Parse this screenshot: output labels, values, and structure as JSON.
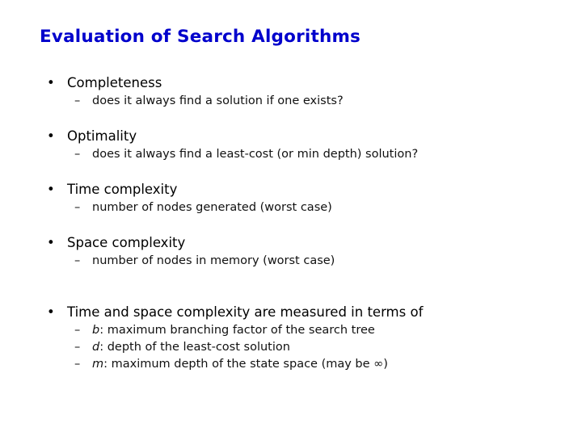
{
  "slide": {
    "title": "Evaluation of Search Algorithms",
    "bullet_glyph": "•",
    "dash_glyph": "–",
    "bullets": [
      {
        "label": "Completeness",
        "subs": [
          {
            "var": "",
            "text": "does it always find a solution if one exists?"
          }
        ]
      },
      {
        "label": "Optimality",
        "subs": [
          {
            "var": "",
            "text": "does it always find a least-cost (or min depth) solution?"
          }
        ]
      },
      {
        "label": "Time complexity",
        "subs": [
          {
            "var": "",
            "text": "number of nodes generated (worst case)"
          }
        ]
      },
      {
        "label": "Space complexity",
        "subs": [
          {
            "var": "",
            "text": "number of nodes in memory (worst case)"
          }
        ]
      },
      {
        "label": "Time and space complexity are measured in terms of",
        "subs": [
          {
            "var": "b",
            "text": ": maximum branching factor of the search tree"
          },
          {
            "var": "d",
            "text": ": depth of the least-cost solution"
          },
          {
            "var": "m",
            "text": ": maximum depth of the state space (may be ∞)"
          }
        ]
      }
    ]
  }
}
